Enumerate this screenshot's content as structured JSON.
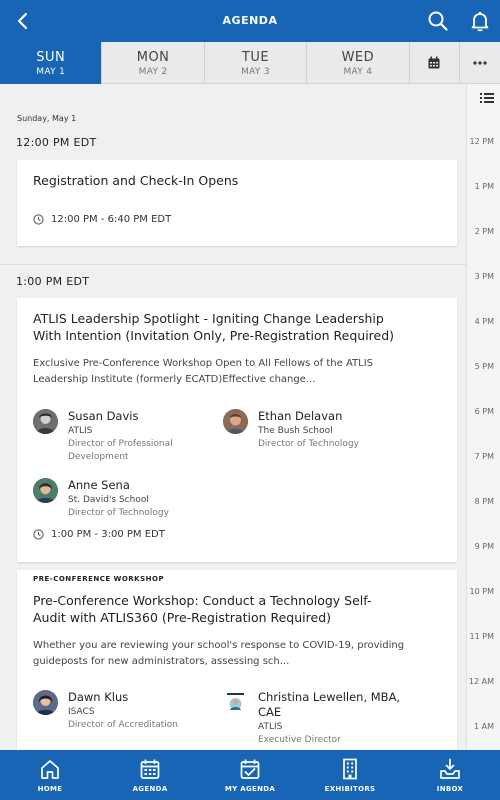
{
  "header": {
    "title": "AGENDA"
  },
  "days": [
    {
      "day": "SUN",
      "date": "MAY 1"
    },
    {
      "day": "MON",
      "date": "MAY 2"
    },
    {
      "day": "TUE",
      "date": "MAY 3"
    },
    {
      "day": "WED",
      "date": "MAY 4"
    }
  ],
  "date_label": "Sunday, May 1",
  "sections": [
    {
      "time": "12:00 PM EDT"
    },
    {
      "time": "1:00 PM EDT"
    }
  ],
  "sessions": [
    {
      "title": "Registration and Check-In Opens",
      "time": "12:00 PM - 6:40 PM EDT"
    },
    {
      "title_line1": "ATLIS Leadership Spotlight - Igniting Change Leadership",
      "title_line2": "With Intention (Invitation Only, Pre-Registration Required)",
      "desc_line1": "Exclusive Pre-Conference Workshop Open to All Fellows of the ATLIS",
      "desc_line2": "Leadership Institute (formerly ECATD)Effective change...",
      "speakers": [
        {
          "name": "Susan Davis",
          "org": "ATLIS",
          "role_line1": "Director of Professional",
          "role_line2": "Development"
        },
        {
          "name": "Ethan Delavan",
          "org": "The Bush School",
          "role_line1": "Director of Technology"
        },
        {
          "name": "Anne Sena",
          "org": "St. David's School",
          "role_line1": "Director of Technology"
        }
      ],
      "time": "1:00 PM - 3:00 PM EDT"
    },
    {
      "badge": "PRE-CONFERENCE WORKSHOP",
      "title_line1": "Pre-Conference Workshop: Conduct a Technology Self-",
      "title_line2": "Audit with ATLIS360 (Pre-Registration Required)",
      "desc_line1": "Whether you are reviewing your school's response to COVID-19, providing",
      "desc_line2": "guideposts for new administrators, assessing sch...",
      "speakers": [
        {
          "name": "Dawn Klus",
          "org": "ISACS",
          "role_line1": "Director of Accreditation"
        },
        {
          "name_line1": "Christina Lewellen, MBA,",
          "name_line2": "CAE",
          "org": "ATLIS",
          "role_line1": "Executive Director"
        }
      ]
    }
  ],
  "rail": {
    "ticks": [
      "12 PM",
      "1 PM",
      "2 PM",
      "3 PM",
      "4 PM",
      "5 PM",
      "6 PM",
      "7 PM",
      "8 PM",
      "9 PM",
      "10 PM",
      "11 PM",
      "12 AM",
      "1 AM"
    ]
  },
  "nav": [
    {
      "label": "HOME",
      "icon": "home-icon"
    },
    {
      "label": "AGENDA",
      "icon": "calendar-icon"
    },
    {
      "label": "MY AGENDA",
      "icon": "calendar-check-icon"
    },
    {
      "label": "EXHIBITORS",
      "icon": "building-icon"
    },
    {
      "label": "INBOX",
      "icon": "inbox-icon"
    }
  ],
  "colors": {
    "brand": "#1765b4",
    "background": "#f0f0f0"
  }
}
